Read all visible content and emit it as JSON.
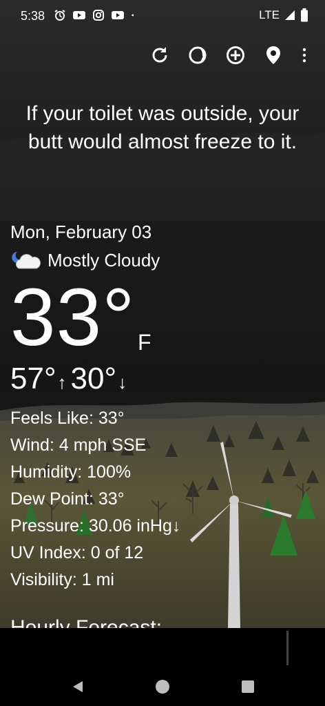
{
  "status_bar": {
    "time": "5:38",
    "notification_icons": [
      "alarm-icon",
      "youtube-icon",
      "instagram-icon",
      "youtube-icon",
      "dot-icon"
    ],
    "network": "LTE",
    "signal_icon": "signal-icon",
    "battery_icon": "battery-icon"
  },
  "toolbar": {
    "buttons": [
      "refresh-icon",
      "theme-icon",
      "add-location-icon",
      "location-pin-icon",
      "more-options-icon"
    ]
  },
  "quote": "If your toilet was outside, your butt would almost freeze to it.",
  "weather": {
    "date": "Mon, February 03",
    "condition": "Mostly Cloudy",
    "condition_icon": "partly-cloudy-night-icon",
    "temperature": "33°",
    "unit": "F",
    "high": "57°",
    "high_arrow": "↑",
    "low": "30°",
    "low_arrow": "↓"
  },
  "details": {
    "feels_like": "Feels Like:  33°",
    "wind": "Wind:  4 mph SSE",
    "humidity": "Humidity:  100%",
    "dew_point": "Dew Point:  33°",
    "pressure": "Pressure:  30.06 inHg↓",
    "uv_index": "UV Index:  0 of 12",
    "visibility": "Visibility:  1 mi"
  },
  "hourly_title": "Hourly Forecast:",
  "nav_bar": {
    "buttons": [
      "back-icon",
      "home-icon",
      "recents-icon"
    ]
  },
  "colors": {
    "text": "#ffffff",
    "background_dark": "#1b1b1b",
    "field": "#4a4830",
    "tree": "#2c7a2e"
  }
}
